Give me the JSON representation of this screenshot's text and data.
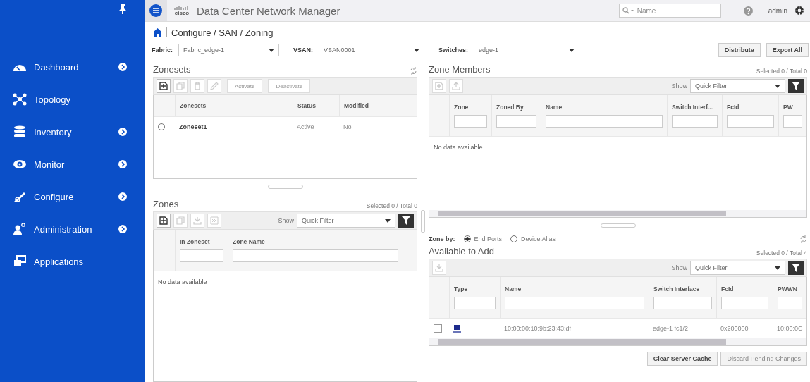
{
  "sidebar": {
    "items": [
      {
        "label": "Dashboard",
        "kind": "dashboard",
        "expandable": true
      },
      {
        "label": "Topology",
        "kind": "topology",
        "expandable": false
      },
      {
        "label": "Inventory",
        "kind": "inventory",
        "expandable": true
      },
      {
        "label": "Monitor",
        "kind": "monitor",
        "expandable": true
      },
      {
        "label": "Configure",
        "kind": "configure",
        "expandable": true
      },
      {
        "label": "Administration",
        "kind": "administration",
        "expandable": true
      },
      {
        "label": "Applications",
        "kind": "applications",
        "expandable": false
      }
    ]
  },
  "header": {
    "logo": "cisco",
    "title": "Data Center Network Manager",
    "search": {
      "placeholder": "Name"
    },
    "user": "admin"
  },
  "breadcrumb": "Configure / SAN / Zoning",
  "filters": [
    {
      "label": "Fabric:",
      "value": "Fabric_edge-1"
    },
    {
      "label": "VSAN:",
      "value": "VSAN0001"
    },
    {
      "label": "Switches:",
      "value": "edge-1"
    }
  ],
  "actions": [
    "Distribute",
    "Export All"
  ],
  "zonesets": {
    "title": "Zonesets",
    "tools": [
      {
        "kind": "add",
        "disabled": false
      },
      {
        "kind": "copy",
        "disabled": true
      },
      {
        "kind": "delete",
        "disabled": true
      },
      {
        "kind": "edit",
        "disabled": true
      }
    ],
    "buttons": [
      {
        "label": "Activate",
        "disabled": true
      },
      {
        "label": "Deactivate",
        "disabled": true
      }
    ],
    "columns": [
      "Zonesets",
      "Status",
      "Modified"
    ],
    "rows": [
      {
        "name": "Zoneset1",
        "status": "Active",
        "modified": "No",
        "selected": false
      }
    ]
  },
  "zones": {
    "title": "Zones",
    "counter": "Selected 0 / Total 0",
    "tools": [
      {
        "kind": "add",
        "disabled": false
      },
      {
        "kind": "copy",
        "disabled": true
      },
      {
        "kind": "download",
        "disabled": true
      },
      {
        "kind": "move",
        "disabled": true
      }
    ],
    "show_label": "Show",
    "filter": "Quick Filter",
    "columns": [
      "In Zoneset",
      "Zone Name"
    ],
    "empty": "No data available"
  },
  "zone_members": {
    "title": "Zone Members",
    "counter": "Selected 0 / Total 0",
    "tools": [
      {
        "kind": "add",
        "disabled": true
      },
      {
        "kind": "upload",
        "disabled": true
      }
    ],
    "show_label": "Show",
    "filter": "Quick Filter",
    "columns": [
      "Zone",
      "Zoned By",
      "Name",
      "Switch Interf...",
      "FcId",
      "PW"
    ],
    "empty": "No data available"
  },
  "zone_by": {
    "label": "Zone by:",
    "options": [
      {
        "label": "End Ports",
        "selected": true
      },
      {
        "label": "Device Alias",
        "selected": false
      }
    ]
  },
  "available": {
    "title": "Available to Add",
    "counter": "Selected 0 / Total 4",
    "tools": [
      {
        "kind": "download",
        "disabled": true
      }
    ],
    "show_label": "Show",
    "filter": "Quick Filter",
    "columns": [
      "Type",
      "Name",
      "Switch Interface",
      "FcId",
      "PWWN"
    ],
    "rows": [
      {
        "checked": false,
        "kind": "host",
        "name": "10:00:00:10:9b:23:43:df",
        "interface": "edge-1 fc1/2",
        "fcid": "0x200000",
        "pwwn": "10:00:0C"
      }
    ]
  },
  "footer": [
    {
      "label": "Clear Server Cache",
      "disabled": false
    },
    {
      "label": "Discard Pending Changes",
      "disabled": true
    }
  ]
}
